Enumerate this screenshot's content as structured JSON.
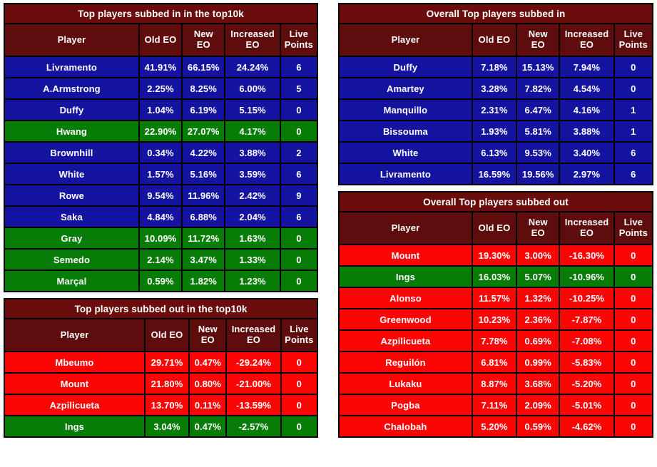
{
  "colors": {
    "title_bg": "#6b0d0d",
    "header_bg": "#5e0c0c",
    "row_blue": "#1414a0",
    "row_green": "#077c07",
    "row_red": "#fc0505",
    "border": "#000000",
    "text": "#ffffff",
    "page_bg": "#ffffff"
  },
  "columns": [
    "Player",
    "Old EO",
    "New EO",
    "Increased EO",
    "Live Points"
  ],
  "column_labels": {
    "player": "Player",
    "old_eo": "Old EO",
    "new_eo_line1": "New",
    "new_eo_line2": "EO",
    "increased_eo_line1": "Increased",
    "increased_eo_line2": "EO",
    "live_points_line1": "Live",
    "live_points_line2": "Points"
  },
  "tables": [
    {
      "id": "top10k-subbed-in",
      "title": "Top players subbed in in the top10k",
      "rows": [
        {
          "player": "Livramento",
          "old_eo": "41.91%",
          "new_eo": "66.15%",
          "increased_eo": "24.24%",
          "live_points": "6",
          "color": "blue"
        },
        {
          "player": "A.Armstrong",
          "old_eo": "2.25%",
          "new_eo": "8.25%",
          "increased_eo": "6.00%",
          "live_points": "5",
          "color": "blue"
        },
        {
          "player": "Duffy",
          "old_eo": "1.04%",
          "new_eo": "6.19%",
          "increased_eo": "5.15%",
          "live_points": "0",
          "color": "blue"
        },
        {
          "player": "Hwang",
          "old_eo": "22.90%",
          "new_eo": "27.07%",
          "increased_eo": "4.17%",
          "live_points": "0",
          "color": "green"
        },
        {
          "player": "Brownhill",
          "old_eo": "0.34%",
          "new_eo": "4.22%",
          "increased_eo": "3.88%",
          "live_points": "2",
          "color": "blue"
        },
        {
          "player": "White",
          "old_eo": "1.57%",
          "new_eo": "5.16%",
          "increased_eo": "3.59%",
          "live_points": "6",
          "color": "blue"
        },
        {
          "player": "Rowe",
          "old_eo": "9.54%",
          "new_eo": "11.96%",
          "increased_eo": "2.42%",
          "live_points": "9",
          "color": "blue"
        },
        {
          "player": "Saka",
          "old_eo": "4.84%",
          "new_eo": "6.88%",
          "increased_eo": "2.04%",
          "live_points": "6",
          "color": "blue"
        },
        {
          "player": "Gray",
          "old_eo": "10.09%",
          "new_eo": "11.72%",
          "increased_eo": "1.63%",
          "live_points": "0",
          "color": "green"
        },
        {
          "player": "Semedo",
          "old_eo": "2.14%",
          "new_eo": "3.47%",
          "increased_eo": "1.33%",
          "live_points": "0",
          "color": "green"
        },
        {
          "player": "Marçal",
          "old_eo": "0.59%",
          "new_eo": "1.82%",
          "increased_eo": "1.23%",
          "live_points": "0",
          "color": "green"
        }
      ]
    },
    {
      "id": "top10k-subbed-out",
      "title": "Top players subbed out in the top10k",
      "rows": [
        {
          "player": "Mbeumo",
          "old_eo": "29.71%",
          "new_eo": "0.47%",
          "increased_eo": "-29.24%",
          "live_points": "0",
          "color": "red"
        },
        {
          "player": "Mount",
          "old_eo": "21.80%",
          "new_eo": "0.80%",
          "increased_eo": "-21.00%",
          "live_points": "0",
          "color": "red"
        },
        {
          "player": "Azpilicueta",
          "old_eo": "13.70%",
          "new_eo": "0.11%",
          "increased_eo": "-13.59%",
          "live_points": "0",
          "color": "red"
        },
        {
          "player": "Ings",
          "old_eo": "3.04%",
          "new_eo": "0.47%",
          "increased_eo": "-2.57%",
          "live_points": "0",
          "color": "green"
        }
      ]
    },
    {
      "id": "overall-subbed-in",
      "title": "Overall Top players subbed in",
      "rows": [
        {
          "player": "Duffy",
          "old_eo": "7.18%",
          "new_eo": "15.13%",
          "increased_eo": "7.94%",
          "live_points": "0",
          "color": "blue"
        },
        {
          "player": "Amartey",
          "old_eo": "3.28%",
          "new_eo": "7.82%",
          "increased_eo": "4.54%",
          "live_points": "0",
          "color": "blue"
        },
        {
          "player": "Manquillo",
          "old_eo": "2.31%",
          "new_eo": "6.47%",
          "increased_eo": "4.16%",
          "live_points": "1",
          "color": "blue"
        },
        {
          "player": "Bissouma",
          "old_eo": "1.93%",
          "new_eo": "5.81%",
          "increased_eo": "3.88%",
          "live_points": "1",
          "color": "blue"
        },
        {
          "player": "White",
          "old_eo": "6.13%",
          "new_eo": "9.53%",
          "increased_eo": "3.40%",
          "live_points": "6",
          "color": "blue"
        },
        {
          "player": "Livramento",
          "old_eo": "16.59%",
          "new_eo": "19.56%",
          "increased_eo": "2.97%",
          "live_points": "6",
          "color": "blue"
        }
      ]
    },
    {
      "id": "overall-subbed-out",
      "title": "Overall Top players subbed out",
      "rows": [
        {
          "player": "Mount",
          "old_eo": "19.30%",
          "new_eo": "3.00%",
          "increased_eo": "-16.30%",
          "live_points": "0",
          "color": "red"
        },
        {
          "player": "Ings",
          "old_eo": "16.03%",
          "new_eo": "5.07%",
          "increased_eo": "-10.96%",
          "live_points": "0",
          "color": "green"
        },
        {
          "player": "Alonso",
          "old_eo": "11.57%",
          "new_eo": "1.32%",
          "increased_eo": "-10.25%",
          "live_points": "0",
          "color": "red"
        },
        {
          "player": "Greenwood",
          "old_eo": "10.23%",
          "new_eo": "2.36%",
          "increased_eo": "-7.87%",
          "live_points": "0",
          "color": "red"
        },
        {
          "player": "Azpilicueta",
          "old_eo": "7.78%",
          "new_eo": "0.69%",
          "increased_eo": "-7.08%",
          "live_points": "0",
          "color": "red"
        },
        {
          "player": "Reguilón",
          "old_eo": "6.81%",
          "new_eo": "0.99%",
          "increased_eo": "-5.83%",
          "live_points": "0",
          "color": "red"
        },
        {
          "player": "Lukaku",
          "old_eo": "8.87%",
          "new_eo": "3.68%",
          "increased_eo": "-5.20%",
          "live_points": "0",
          "color": "red"
        },
        {
          "player": "Pogba",
          "old_eo": "7.11%",
          "new_eo": "2.09%",
          "increased_eo": "-5.01%",
          "live_points": "0",
          "color": "red"
        },
        {
          "player": "Chalobah",
          "old_eo": "5.20%",
          "new_eo": "0.59%",
          "increased_eo": "-4.62%",
          "live_points": "0",
          "color": "red"
        }
      ]
    }
  ]
}
